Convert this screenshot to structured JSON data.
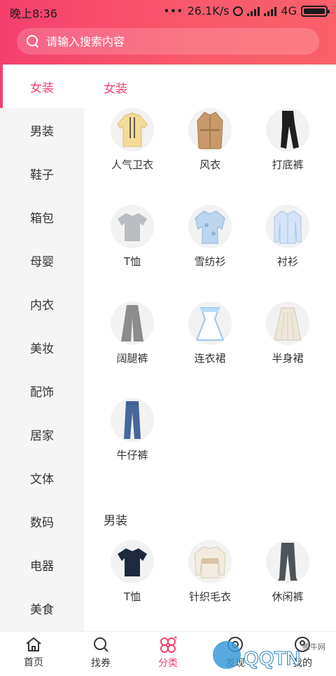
{
  "statusbar": {
    "time": "晚上8:36",
    "dots": "•••",
    "speed": "26.1K/s",
    "network": "4G"
  },
  "search": {
    "placeholder": "请输入搜索内容"
  },
  "sidebar": {
    "items": [
      {
        "label": "女装",
        "active": true
      },
      {
        "label": "男装"
      },
      {
        "label": "鞋子"
      },
      {
        "label": "箱包"
      },
      {
        "label": "母婴"
      },
      {
        "label": "内衣"
      },
      {
        "label": "美妆"
      },
      {
        "label": "配饰"
      },
      {
        "label": "居家"
      },
      {
        "label": "文体"
      },
      {
        "label": "数码"
      },
      {
        "label": "电器"
      },
      {
        "label": "美食"
      }
    ]
  },
  "sections": [
    {
      "title": "女装",
      "items": [
        {
          "label": "人气卫衣",
          "icon": "hoodie-icon"
        },
        {
          "label": "风衣",
          "icon": "trench-coat-icon"
        },
        {
          "label": "打底裤",
          "icon": "leggings-icon"
        },
        {
          "label": "T恤",
          "icon": "tshirt-icon"
        },
        {
          "label": "雪纺衫",
          "icon": "chiffon-shirt-icon"
        },
        {
          "label": "衬衫",
          "icon": "shirt-icon"
        },
        {
          "label": "阔腿裤",
          "icon": "wide-leg-pants-icon"
        },
        {
          "label": "连衣裙",
          "icon": "dress-icon"
        },
        {
          "label": "半身裙",
          "icon": "skirt-icon"
        },
        {
          "label": "牛仔裤",
          "icon": "jeans-icon"
        }
      ]
    },
    {
      "title": "男装",
      "items": [
        {
          "label": "T恤",
          "icon": "tshirt-icon"
        },
        {
          "label": "针织毛衣",
          "icon": "sweater-icon"
        },
        {
          "label": "休闲裤",
          "icon": "casual-pants-icon"
        }
      ]
    }
  ],
  "tabbar": {
    "items": [
      {
        "label": "首页",
        "icon": "home-icon"
      },
      {
        "label": "找券",
        "icon": "search-icon"
      },
      {
        "label": "分类",
        "icon": "category-icon",
        "active": true
      },
      {
        "label": "发现",
        "icon": "discover-icon"
      },
      {
        "label": "我的",
        "icon": "profile-icon"
      }
    ]
  },
  "watermark": {
    "text": "QQTN.com",
    "sub": "腾牛网"
  },
  "colors": {
    "accent": "#f5406e",
    "sidebar_bg": "#f5f5f5"
  }
}
